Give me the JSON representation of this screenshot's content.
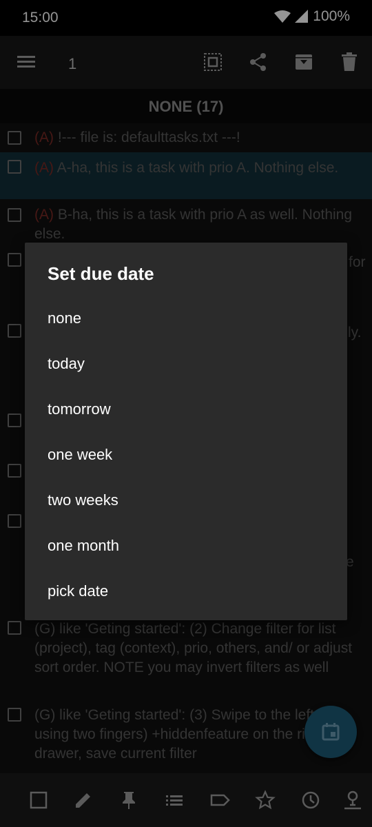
{
  "status_bar": {
    "time": "15:00",
    "battery": "100%"
  },
  "toolbar": {
    "menu_icon": "menu-icon",
    "selected_count": "1",
    "icons": [
      "select-all-icon",
      "share-icon",
      "archive-icon",
      "delete-icon"
    ]
  },
  "list": {
    "section_header": "NONE (17)",
    "tasks": [
      {
        "prio": "(A)",
        "text": " !--- file is: defaulttasks.txt ---!"
      },
      {
        "prio": "(A)",
        "text": " A-ha, this is a task with prio A. Nothing else."
      },
      {
        "prio": "(A)",
        "text": " B-ha, this is a task with prio A as well. Nothing else."
      },
      {
        "frag": "for"
      },
      {
        "frag": "ly."
      },
      {
        "frag": "e"
      },
      {
        "text": "(G) like 'Geting started': (2) Change filter for list (project), tag (context), prio, others, and/ or adjust sort order. NOTE you may invert filters as well"
      },
      {
        "text": "(G) like 'Geting started': (3) Swipe to the left (?using two fingers) +hiddenfeature on the right drawer, save current filter"
      }
    ]
  },
  "dialog": {
    "title": "Set due date",
    "options": [
      "none",
      "today",
      "tomorrow",
      "one week",
      "two weeks",
      "one month",
      "pick date"
    ]
  },
  "fab": {
    "icon": "calendar-icon"
  },
  "bottom_bar": {
    "icons": [
      "checkbox-icon",
      "edit-icon",
      "pin-icon",
      "list-icon",
      "tag-icon",
      "star-icon",
      "clock-icon",
      "due-date-icon"
    ]
  },
  "colors": {
    "accent": "#1d5a76",
    "priority": "#7a2a25",
    "selected_row": "#12303a",
    "dialog_bg": "#2b2b2b"
  }
}
